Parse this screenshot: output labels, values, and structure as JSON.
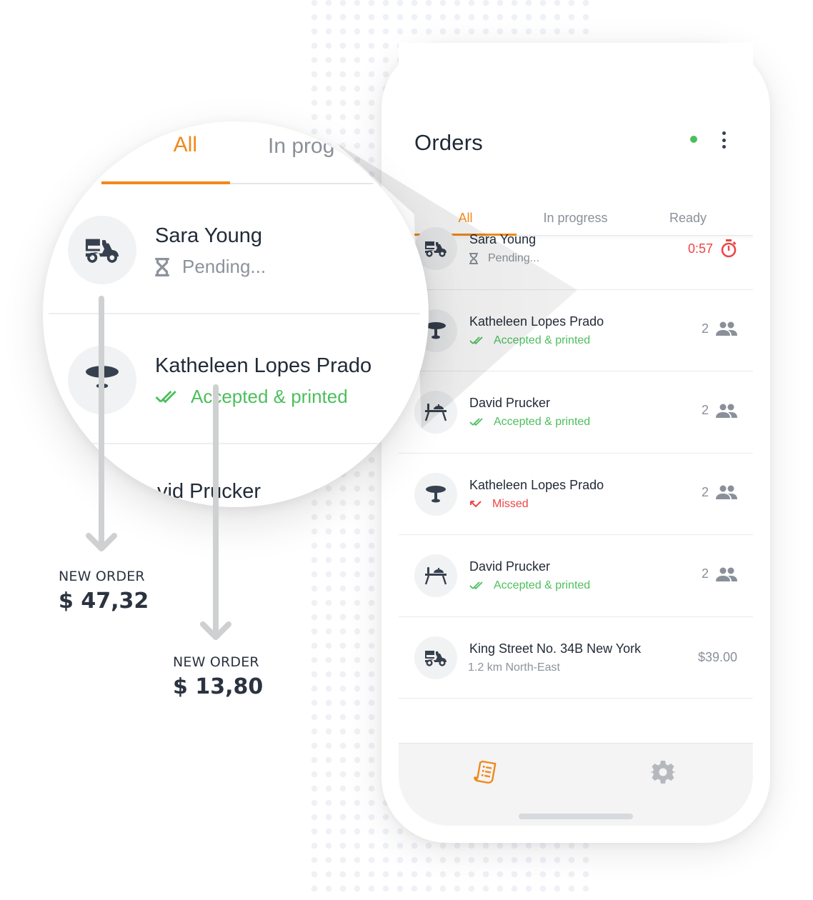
{
  "app": {
    "title": "Orders",
    "connection_status_color": "#4cbf5d",
    "menu_icon": "more-vertical-icon"
  },
  "tabs": [
    {
      "label": "All",
      "active": true
    },
    {
      "label": "In progress",
      "active": false
    },
    {
      "label": "Ready",
      "active": false
    }
  ],
  "orders": [
    {
      "icon": "scooter-delivery-icon",
      "name": "Sara Young",
      "status_icon": "hourglass-icon",
      "status": "Pending...",
      "status_type": "pending",
      "right_text": "0:57",
      "right_icon": "stopwatch-icon",
      "right_type": "timer"
    },
    {
      "icon": "round-table-icon",
      "name": "Katheleen Lopes Prado",
      "status_icon": "double-check-icon",
      "status": "Accepted & printed",
      "status_type": "accepted",
      "right_text": "2",
      "right_icon": "people-icon",
      "right_type": "guests"
    },
    {
      "icon": "dining-table-icon",
      "name": "David Prucker",
      "status_icon": "double-check-icon",
      "status": "Accepted & printed",
      "status_type": "accepted",
      "right_text": "2",
      "right_icon": "people-icon",
      "right_type": "guests"
    },
    {
      "icon": "round-table-icon",
      "name": "Katheleen Lopes Prado",
      "status_icon": "missed-call-icon",
      "status": "Missed",
      "status_type": "missed",
      "right_text": "2",
      "right_icon": "people-icon",
      "right_type": "guests"
    },
    {
      "icon": "dining-table-icon",
      "name": "David Prucker",
      "status_icon": "double-check-icon",
      "status": "Accepted & printed",
      "status_type": "accepted",
      "right_text": "2",
      "right_icon": "people-icon",
      "right_type": "guests"
    },
    {
      "icon": "scooter-delivery-icon",
      "name": "King Street No. 34B New York",
      "status_icon": "",
      "status": "1.2 km North-East",
      "status_type": "sub",
      "right_text": "$39.00",
      "right_icon": "",
      "right_type": "price"
    }
  ],
  "bottom_nav": [
    {
      "icon": "orders-receipt-icon",
      "active": true
    },
    {
      "icon": "settings-gear-icon",
      "active": false
    }
  ],
  "magnifier": {
    "tab_all": "All",
    "tab_in_progress": "In prog",
    "rows": [
      {
        "name": "Sara Young",
        "status": "Pending...",
        "status_type": "pending"
      },
      {
        "name": "Katheleen Lopes Prado",
        "status": "Accepted & printed",
        "status_type": "accepted"
      }
    ],
    "partial_row_name": "vid Prucker"
  },
  "callouts": [
    {
      "label": "NEW ORDER",
      "amount": "$ 47,32"
    },
    {
      "label": "NEW ORDER",
      "amount": "$ 13,80"
    }
  ],
  "colors": {
    "accent": "#f0891b",
    "success": "#4cbf5d",
    "danger": "#ee4444",
    "muted": "#8a9099",
    "text": "#222b38"
  }
}
